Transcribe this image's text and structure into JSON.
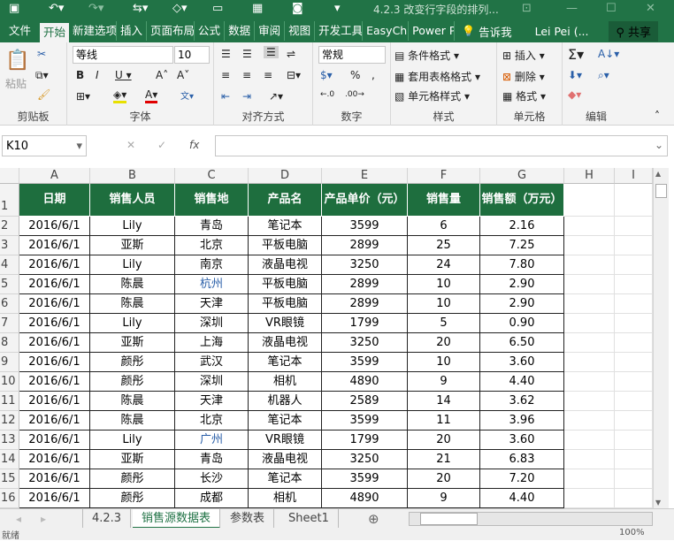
{
  "window": {
    "title": "4.2.3 改变行字段的排列..."
  },
  "menu": [
    "文件",
    "开始",
    "新建选项",
    "插入",
    "页面布局",
    "公式",
    "数据",
    "审阅",
    "视图",
    "开发工具",
    "EasyCha",
    "Power P"
  ],
  "tell_me": "告诉我",
  "user": "Lei Pei (...",
  "share": "共享",
  "ribbon": {
    "paste": "粘贴",
    "clipboard": "剪贴板",
    "font_name": "等线",
    "font_size": "10",
    "font": "字体",
    "alignment": "对齐方式",
    "number_format": "常规",
    "number": "数字",
    "cond_format": "条件格式",
    "table_format": "套用表格格式",
    "cell_style": "单元格样式",
    "styles": "样式",
    "insert": "插入",
    "delete": "删除",
    "format": "格式",
    "cells": "单元格",
    "editing": "编辑"
  },
  "name_box": "K10",
  "columns": [
    "A",
    "B",
    "C",
    "D",
    "E",
    "F",
    "G",
    "H",
    "I"
  ],
  "headers": [
    "日期",
    "销售人员",
    "销售地",
    "产品名",
    "产品单价（元）",
    "销售量",
    "销售额（万元）"
  ],
  "rows": [
    [
      "2016/6/1",
      "Lily",
      "青岛",
      "笔记本",
      "3599",
      "6",
      "2.16"
    ],
    [
      "2016/6/1",
      "亚斯",
      "北京",
      "平板电脑",
      "2899",
      "25",
      "7.25"
    ],
    [
      "2016/6/1",
      "Lily",
      "南京",
      "液晶电视",
      "3250",
      "24",
      "7.80"
    ],
    [
      "2016/6/1",
      "陈晨",
      "杭州",
      "平板电脑",
      "2899",
      "10",
      "2.90"
    ],
    [
      "2016/6/1",
      "陈晨",
      "天津",
      "平板电脑",
      "2899",
      "10",
      "2.90"
    ],
    [
      "2016/6/1",
      "Lily",
      "深圳",
      "VR眼镜",
      "1799",
      "5",
      "0.90"
    ],
    [
      "2016/6/1",
      "亚斯",
      "上海",
      "液晶电视",
      "3250",
      "20",
      "6.50"
    ],
    [
      "2016/6/1",
      "颜彤",
      "武汉",
      "笔记本",
      "3599",
      "10",
      "3.60"
    ],
    [
      "2016/6/1",
      "颜彤",
      "深圳",
      "相机",
      "4890",
      "9",
      "4.40"
    ],
    [
      "2016/6/1",
      "陈晨",
      "天津",
      "机器人",
      "2589",
      "14",
      "3.62"
    ],
    [
      "2016/6/1",
      "陈晨",
      "北京",
      "笔记本",
      "3599",
      "11",
      "3.96"
    ],
    [
      "2016/6/1",
      "Lily",
      "广州",
      "VR眼镜",
      "1799",
      "20",
      "3.60"
    ],
    [
      "2016/6/1",
      "亚斯",
      "青岛",
      "液晶电视",
      "3250",
      "21",
      "6.83"
    ],
    [
      "2016/6/1",
      "颜彤",
      "长沙",
      "笔记本",
      "3599",
      "20",
      "7.20"
    ],
    [
      "2016/6/1",
      "颜彤",
      "成都",
      "相机",
      "4890",
      "9",
      "4.40"
    ]
  ],
  "sheet_tabs": [
    "4.2.3",
    "销售源数据表",
    "参数表",
    "Sheet1"
  ],
  "active_sheet": "销售源数据表",
  "status": {
    "ready": "就绪",
    "zoom": "100%"
  }
}
